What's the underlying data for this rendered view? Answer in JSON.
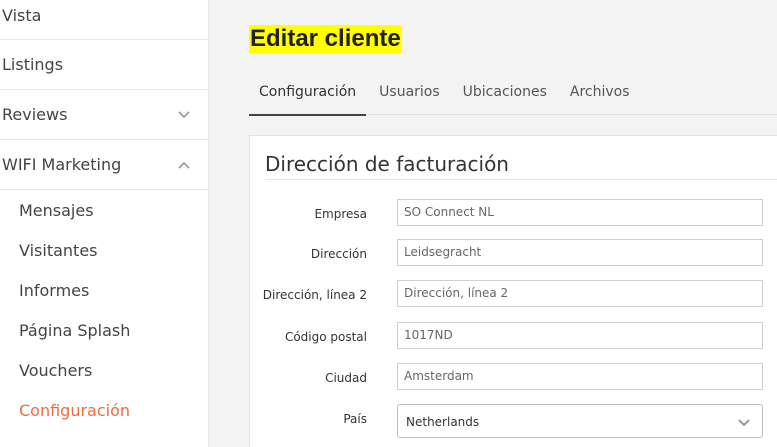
{
  "sidebar": {
    "items": [
      {
        "label": "Vista"
      },
      {
        "label": "Listings"
      },
      {
        "label": "Reviews",
        "icon": "chevron-down-icon"
      },
      {
        "label": "WIFI Marketing",
        "icon": "chevron-up-icon"
      }
    ],
    "subitems": [
      {
        "label": "Mensajes"
      },
      {
        "label": "Visitantes"
      },
      {
        "label": "Informes"
      },
      {
        "label": "Página Splash"
      },
      {
        "label": "Vouchers"
      },
      {
        "label": "Configuración",
        "active": true
      }
    ],
    "active_color": "#f06a40"
  },
  "page": {
    "title": "Editar cliente",
    "title_highlight": "#ffff00"
  },
  "tabs": [
    {
      "label": "Configuración",
      "active": true
    },
    {
      "label": "Usuarios"
    },
    {
      "label": "Ubicaciones"
    },
    {
      "label": "Archivos"
    }
  ],
  "billing": {
    "title": "Dirección de facturación",
    "fields": {
      "empresa": {
        "label": "Empresa",
        "value": "SO Connect NL"
      },
      "direccion": {
        "label": "Dirección",
        "value": "Leidsegracht"
      },
      "direccion2": {
        "label": "Dirección, línea 2",
        "placeholder": "Dirección, línea 2"
      },
      "codigo_postal": {
        "label": "Código postal",
        "value": "1017ND"
      },
      "ciudad": {
        "label": "Ciudad",
        "value": "Amsterdam"
      },
      "pais": {
        "label": "País",
        "value": "Netherlands"
      }
    }
  }
}
